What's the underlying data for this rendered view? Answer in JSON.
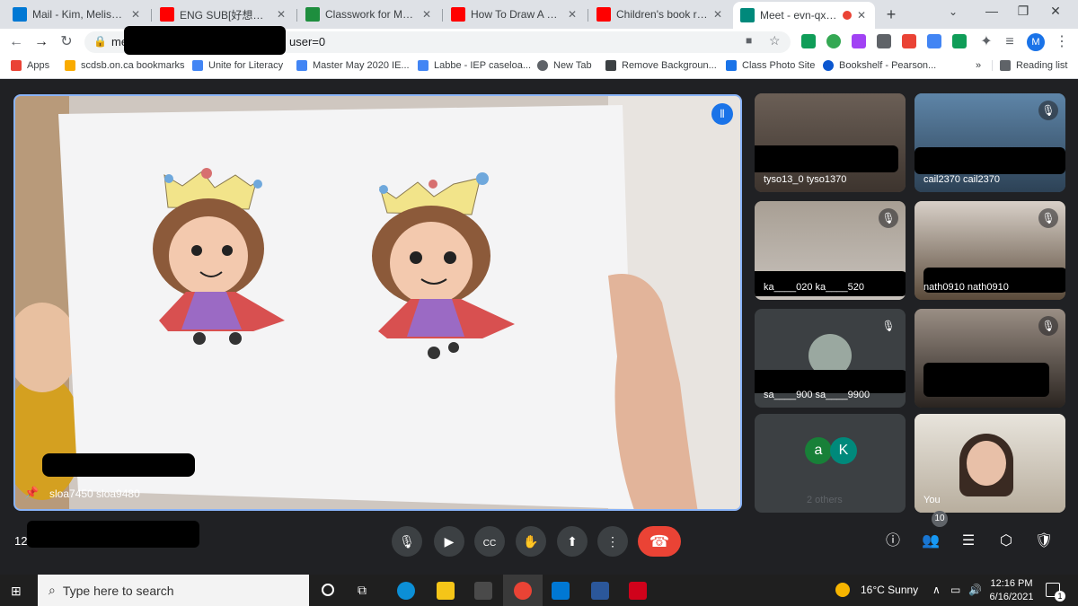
{
  "tabs": [
    {
      "label": "Mail - Kim, Melissa - O",
      "icon": "outlook-icon",
      "color": "#0078d4"
    },
    {
      "label": "ENG SUB[好想和你在",
      "icon": "youtube-icon",
      "color": "#ff0000"
    },
    {
      "label": "Classwork for Mrs. Kim",
      "icon": "classroom-icon",
      "color": "#1e8e3e"
    },
    {
      "label": "How To Draw A King A",
      "icon": "youtube-icon",
      "color": "#ff0000"
    },
    {
      "label": "Children's book read a",
      "icon": "youtube-icon",
      "color": "#ff0000"
    },
    {
      "label": "Meet - evn-qxgs-",
      "icon": "meet-icon",
      "color": "#00897b"
    }
  ],
  "url": {
    "prefix": "me",
    "suffix": "user=0"
  },
  "bookmarks": [
    {
      "label": "Apps",
      "icon": "apps-grid-icon",
      "color": "#ea4335"
    },
    {
      "label": "scdsb.on.ca bookmarks",
      "icon": "folder-icon",
      "color": "#f9ab00"
    },
    {
      "label": "Unite for Literacy",
      "icon": "page-icon",
      "color": "#4285f4"
    },
    {
      "label": "Master May 2020 IE...",
      "icon": "docs-icon",
      "color": "#4285f4"
    },
    {
      "label": "Labbe - IEP caseloa...",
      "icon": "docs-icon",
      "color": "#4285f4"
    },
    {
      "label": "New Tab",
      "icon": "globe-icon",
      "color": "#5f6368"
    },
    {
      "label": "Remove Backgroun...",
      "icon": "removebg-icon",
      "color": "#3c4043"
    },
    {
      "label": "Class Photo Site",
      "icon": "photo-icon",
      "color": "#1a73e8"
    },
    {
      "label": "Bookshelf - Pearson...",
      "icon": "pearson-icon",
      "color": "#0b57d0"
    }
  ],
  "reading_list": "Reading list",
  "overflow": "»",
  "profile_initial": "M",
  "main_video": {
    "label": "sloa7450 sloa9480"
  },
  "tiles": [
    {
      "label": "tyso13_0 tyso1370",
      "muted": false
    },
    {
      "label": "cail2370 cail2370",
      "muted": true
    },
    {
      "label": "ka____020 ka____520",
      "muted": true
    },
    {
      "label": "nath0910 nath0910",
      "muted": true
    },
    {
      "label": "sa____900 sa____9900",
      "muted": true
    },
    {
      "label": "",
      "muted": true
    },
    {
      "label": "2 others",
      "muted": false,
      "avatars": [
        "a",
        "K"
      ]
    },
    {
      "label": "You",
      "muted": false
    }
  ],
  "time": "12:",
  "participants_count": "10",
  "taskbar": {
    "search_placeholder": "Type here to search",
    "weather": "16°C  Sunny",
    "time": "12:16 PM",
    "date": "6/16/2021",
    "notifications": "1"
  },
  "colors": {
    "accent": "#8ab4f8",
    "end_call": "#ea4335",
    "meet_bg": "#202124"
  }
}
